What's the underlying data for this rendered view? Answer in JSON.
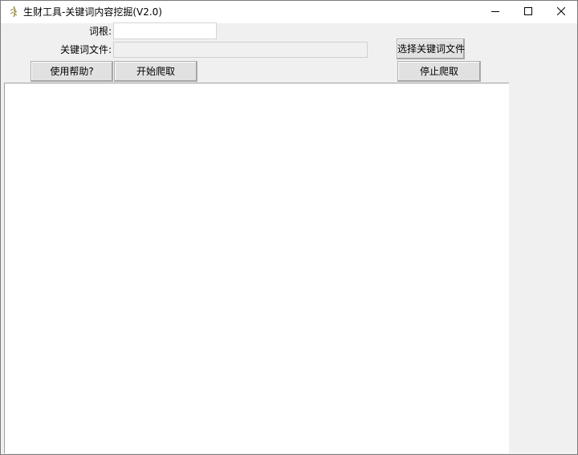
{
  "window": {
    "title": "生财工具-关键词内容挖掘(V2.0)",
    "app_icon": "feather-app-icon",
    "controls": {
      "minimize_icon": "minimize-icon",
      "maximize_icon": "maximize-icon",
      "close_icon": "close-icon"
    }
  },
  "form": {
    "root_label": "词根:",
    "root_value": "",
    "file_label": "关键词文件:",
    "file_value": ""
  },
  "buttons": {
    "select_file": "选择关键词文件",
    "help": "使用帮助?",
    "start": "开始爬取",
    "stop": "停止爬取"
  },
  "output": {
    "text": ""
  }
}
